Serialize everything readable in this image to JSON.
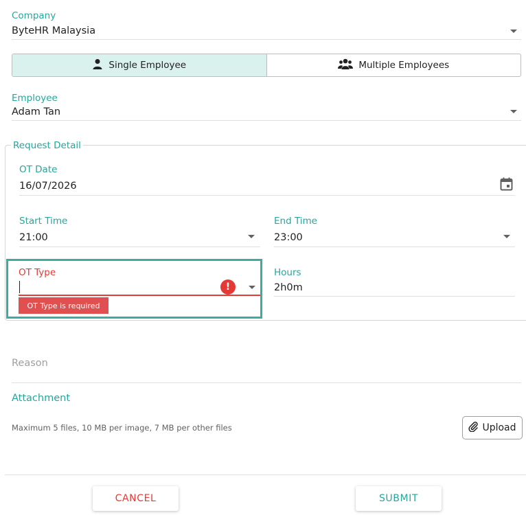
{
  "company": {
    "label": "Company",
    "value": "ByteHR Malaysia"
  },
  "mode_toggle": {
    "single": "Single Employee",
    "multiple": "Multiple Employees",
    "selected": "single"
  },
  "employee": {
    "label": "Employee",
    "value": "Adam Tan"
  },
  "request_detail": {
    "legend": "Request Detail",
    "ot_date": {
      "label": "OT Date",
      "value": "16/07/2026"
    },
    "start_time": {
      "label": "Start Time",
      "value": "21:00"
    },
    "end_time": {
      "label": "End Time",
      "value": "23:00"
    },
    "ot_type": {
      "label": "OT Type",
      "value": "",
      "error": "OT Type is required",
      "error_icon": "!"
    },
    "hours": {
      "label": "Hours",
      "value": "2h0m"
    }
  },
  "reason": {
    "placeholder": "Reason"
  },
  "attachment": {
    "label": "Attachment",
    "hint": "Maximum 5 files, 10 MB per image, 7 MB per other files",
    "upload_label": "Upload"
  },
  "actions": {
    "cancel": "CANCEL",
    "submit": "SUBMIT"
  },
  "colors": {
    "accent": "#26a69a",
    "error": "#e53935",
    "toggle_active": "#d9f2ee"
  }
}
